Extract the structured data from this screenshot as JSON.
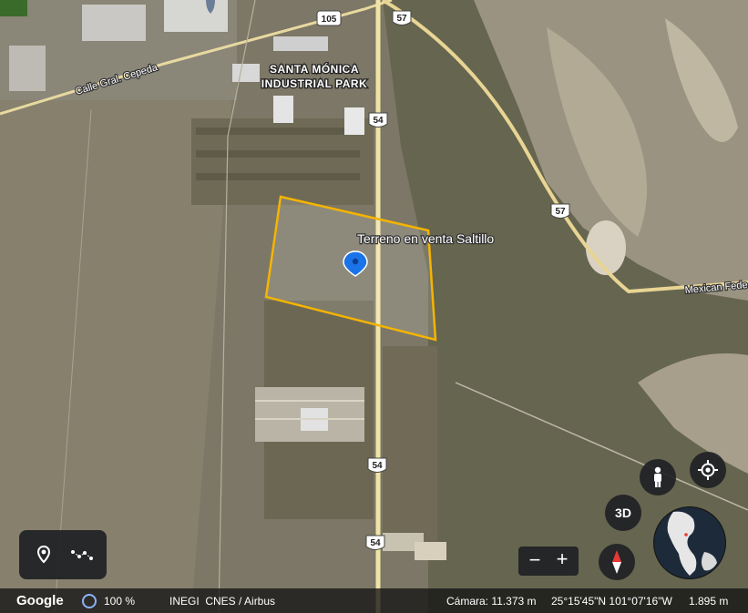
{
  "map": {
    "place_marker_label": "Terreno en venta Saltillo",
    "industrial_park_line1": "SANTA MÓNICA",
    "industrial_park_line2": "INDUSTRIAL PARK",
    "road_labels": {
      "calle": "Calle Gral. Cepeda",
      "mexican_fed": "Mexican Fede"
    },
    "highway_shields": [
      "105",
      "57",
      "54",
      "57",
      "54",
      "54"
    ],
    "parcel_color": "#f5b400",
    "marker_color": "#1a73e8"
  },
  "controls": {
    "three_d_label": "3D",
    "zoom_out_symbol": "−",
    "zoom_in_symbol": "+",
    "place_icon": "map-pin-icon",
    "path_icon": "path-icon",
    "pegman_icon": "pegman-icon",
    "locate_icon": "my-location-icon",
    "compass_icon": "compass-icon",
    "globe_icon": "globe-icon"
  },
  "status": {
    "brand": "Google",
    "zoom_percent": "100 %",
    "attribution": "INEGI  CNES / Airbus",
    "camera": "Cámara: 11.373 m",
    "coordinates": "25°15'45\"N 101°07'16\"W",
    "elevation": "1.895 m"
  }
}
